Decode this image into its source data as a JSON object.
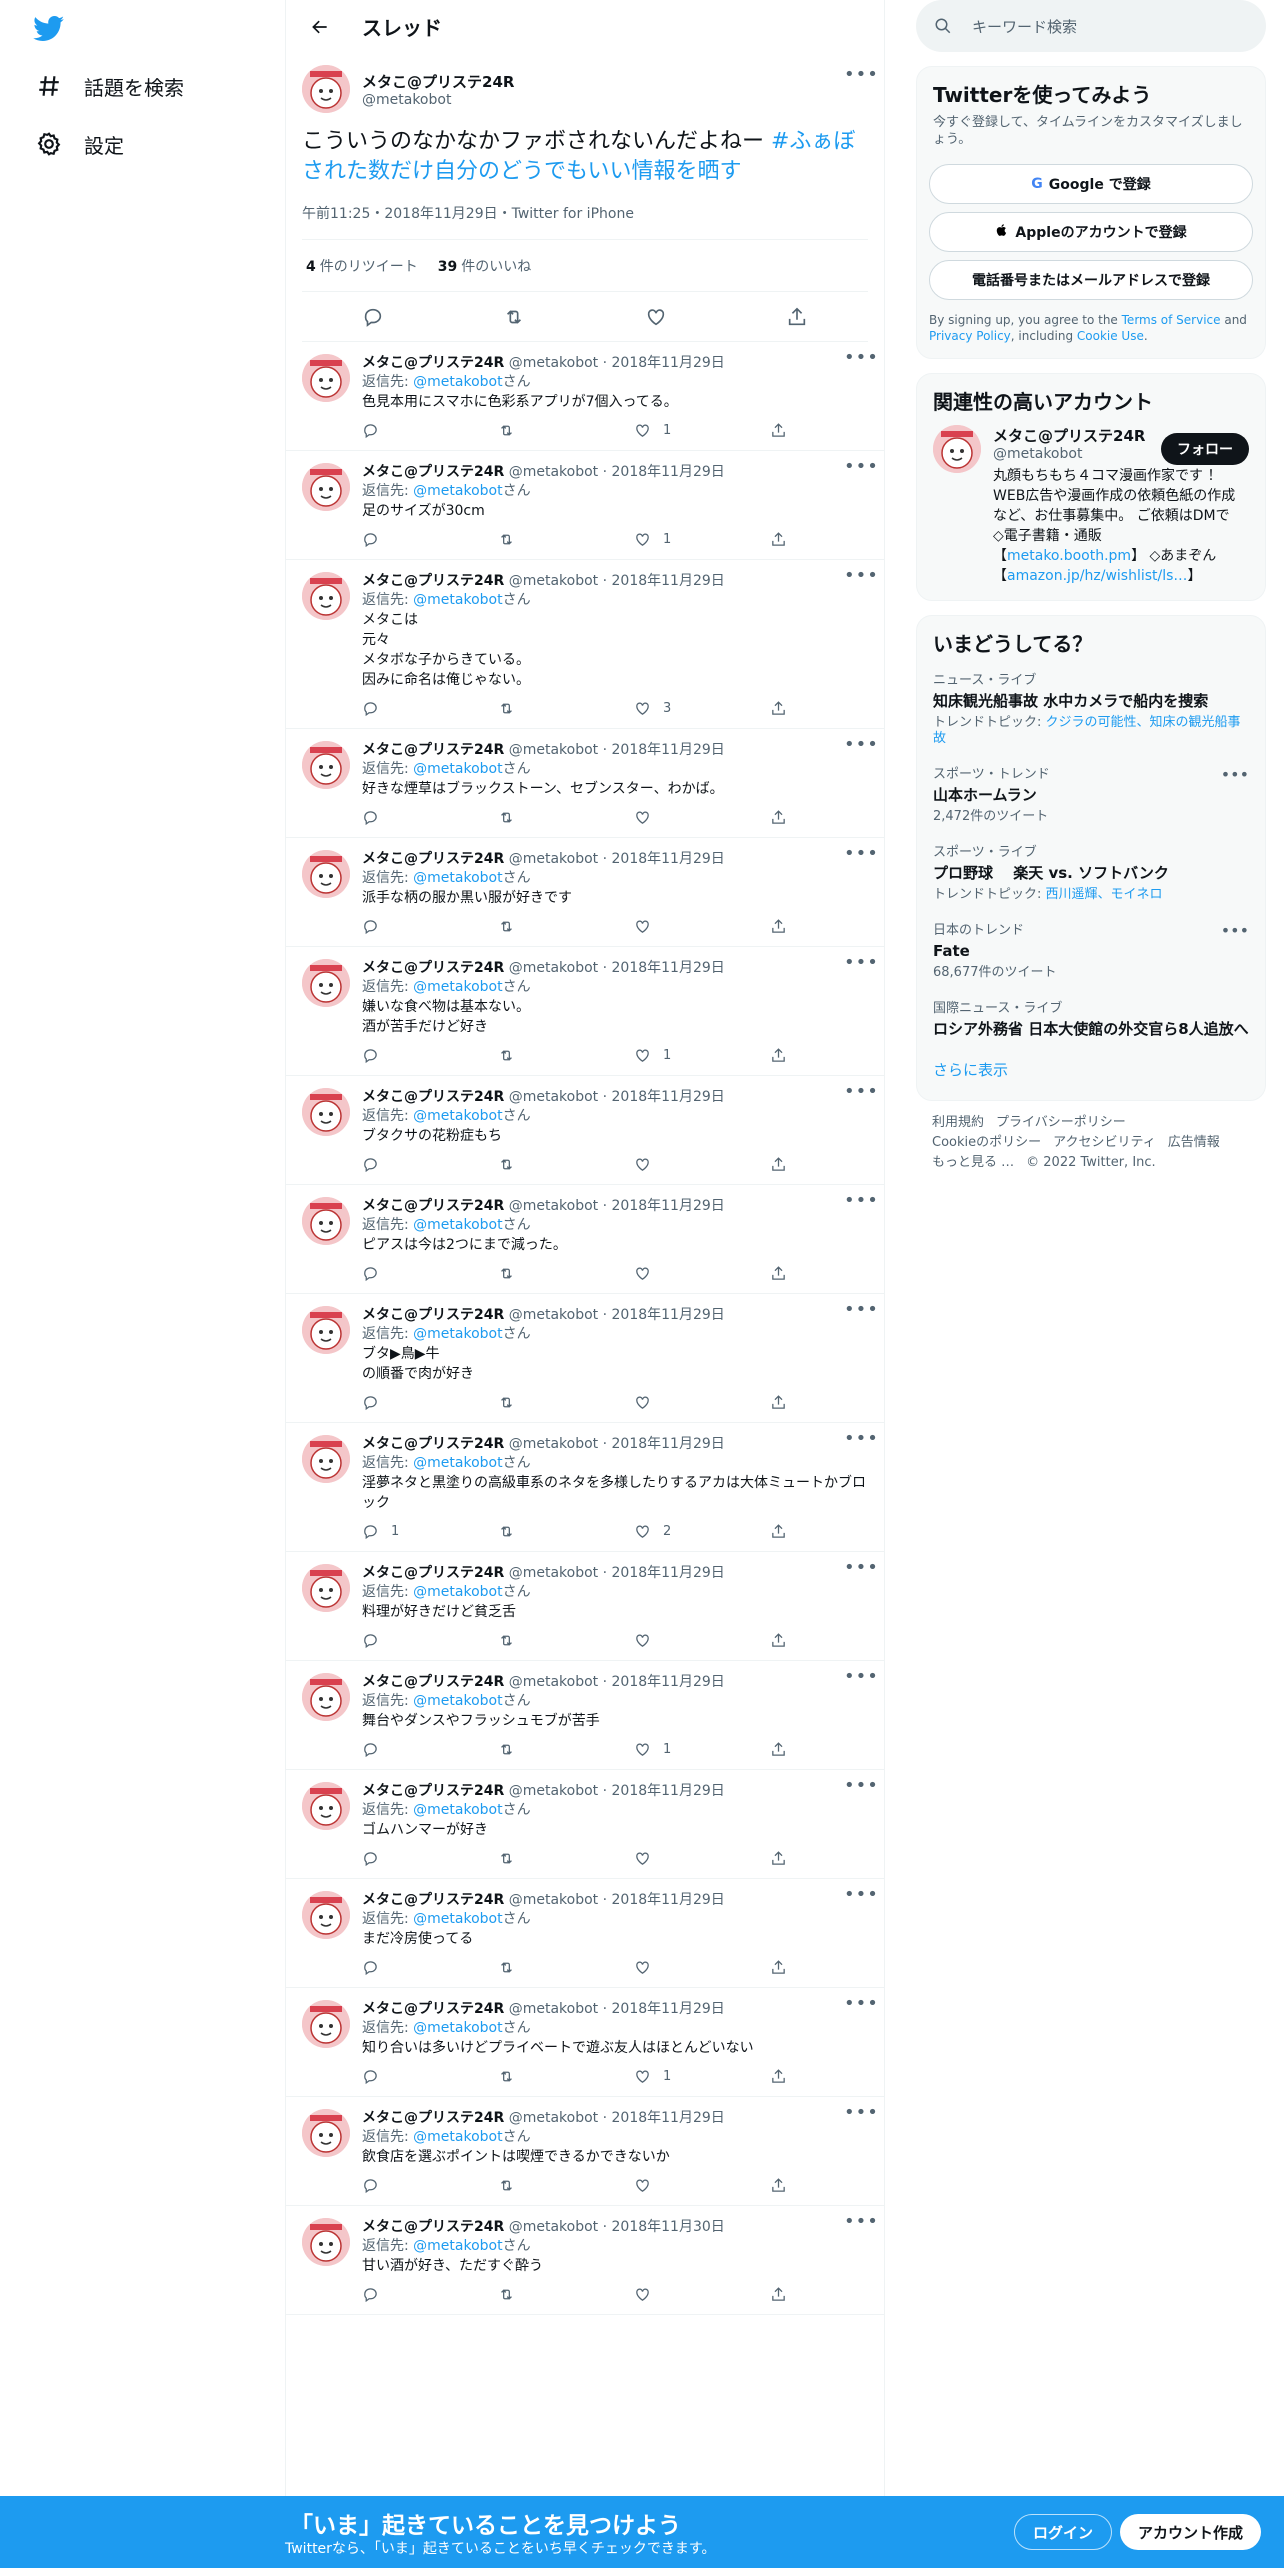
{
  "nav": {
    "explore": "話題を検索",
    "settings": "設定"
  },
  "header": {
    "title": "スレッド"
  },
  "focal": {
    "name": "メタこ@プリステ24R",
    "handle": "@metakobot",
    "text": "こういうのなかなかファボされないんだよねー ",
    "hashtag": "#ふぁぼされた数だけ自分のどうでもいい情報を晒す",
    "meta": "午前11:25・2018年11月29日・Twitter for iPhone",
    "retweets": "4",
    "retweets_label": "件のリツイート",
    "likes": "39",
    "likes_label": "件のいいね"
  },
  "reply_common": {
    "name": "メタこ@プリステ24R",
    "handle": "@metakobot",
    "to_prefix": "返信先: ",
    "to_handle": "@metakobot",
    "to_suffix": "さん"
  },
  "replies": [
    {
      "date": "2018年11月29日",
      "text": "色見本用にスマホに色彩系アプリが7個入ってる。",
      "replies": "",
      "likes": "1"
    },
    {
      "date": "2018年11月29日",
      "text": "足のサイズが30cm",
      "replies": "",
      "likes": "1"
    },
    {
      "date": "2018年11月29日",
      "text": "メタこは\n元々\nメタボな子からきている。\n因みに命名は俺じゃない。",
      "replies": "",
      "likes": "3"
    },
    {
      "date": "2018年11月29日",
      "text": "好きな煙草はブラックストーン、セブンスター、わかば。",
      "replies": "",
      "likes": ""
    },
    {
      "date": "2018年11月29日",
      "text": "派手な柄の服か黒い服が好きです",
      "replies": "",
      "likes": ""
    },
    {
      "date": "2018年11月29日",
      "text": "嫌いな食べ物は基本ない。\n酒が苦手だけど好き",
      "replies": "",
      "likes": "1"
    },
    {
      "date": "2018年11月29日",
      "text": "ブタクサの花粉症もち",
      "replies": "",
      "likes": ""
    },
    {
      "date": "2018年11月29日",
      "text": "ピアスは今は2つにまで減った。",
      "replies": "",
      "likes": ""
    },
    {
      "date": "2018年11月29日",
      "text": "ブタ▶鳥▶牛\nの順番で肉が好き",
      "replies": "",
      "likes": ""
    },
    {
      "date": "2018年11月29日",
      "text": "淫夢ネタと黒塗りの高級車系のネタを多様したりするアカは大体ミュートかブロック",
      "replies": "1",
      "likes": "2"
    },
    {
      "date": "2018年11月29日",
      "text": "料理が好きだけど貧乏舌",
      "replies": "",
      "likes": ""
    },
    {
      "date": "2018年11月29日",
      "text": "舞台やダンスやフラッシュモブが苦手",
      "replies": "",
      "likes": "1"
    },
    {
      "date": "2018年11月29日",
      "text": "ゴムハンマーが好き",
      "replies": "",
      "likes": ""
    },
    {
      "date": "2018年11月29日",
      "text": "まだ冷房使ってる",
      "replies": "",
      "likes": ""
    },
    {
      "date": "2018年11月29日",
      "text": "知り合いは多いけどプライベートで遊ぶ友人はほとんどいない",
      "replies": "",
      "likes": "1"
    },
    {
      "date": "2018年11月29日",
      "text": "飲食店を選ぶポイントは喫煙できるかできないか",
      "replies": "",
      "likes": ""
    },
    {
      "date": "2018年11月30日",
      "text": "甘い酒が好き、ただすぐ酔う",
      "replies": "",
      "likes": ""
    }
  ],
  "search": {
    "placeholder": "キーワード検索"
  },
  "signup": {
    "title": "Twitterを使ってみよう",
    "desc": "今すぐ登録して、タイムラインをカスタマイズしましょう。",
    "google": "Google で登録",
    "apple": "Appleのアカウントで登録",
    "phone": "電話番号またはメールアドレスで登録",
    "legal_1": "By signing up, you agree to the ",
    "legal_tos": "Terms of Service",
    "legal_2": " and ",
    "legal_privacy": "Privacy Policy",
    "legal_3": ", including ",
    "legal_cookie": "Cookie Use",
    "legal_4": "."
  },
  "related": {
    "title": "関連性の高いアカウント",
    "name": "メタこ@プリステ24R",
    "handle": "@metakobot",
    "follow": "フォロー",
    "bio_1": "丸顔もちもち４コマ漫画作家です ！WEB広告や漫画作成の依頼色紙の作成など、お仕事募集中。 ご依頼はDMで　 ◇電子書籍・通販【",
    "bio_link1": "metako.booth.pm",
    "bio_2": "】 ◇あまぞん【",
    "bio_link2": "amazon.jp/hz/wishlist/ls…",
    "bio_3": "】"
  },
  "trends": {
    "title": "いまどうしてる？",
    "items": [
      {
        "meta": "ニュース・ライブ",
        "title": "知床観光船事故 水中カメラで船内を捜索",
        "sub_prefix": "トレンドトピック: ",
        "sub_link": "クジラの可能性、知床の観光船事故",
        "count": ""
      },
      {
        "meta": "スポーツ・トレンド",
        "title": "山本ホームラン",
        "sub_prefix": "",
        "sub_link": "",
        "count": "2,472件のツイート"
      },
      {
        "meta": "スポーツ・ライブ",
        "title": "プロ野球　 楽天 vs. ソフトバンク",
        "sub_prefix": "トレンドトピック: ",
        "sub_link": "西川遥輝、モイネロ",
        "count": ""
      },
      {
        "meta": "日本のトレンド",
        "title": "Fate",
        "sub_prefix": "",
        "sub_link": "",
        "count": "68,677件のツイート"
      },
      {
        "meta": "国際ニュース・ライブ",
        "title": "ロシア外務省 日本大使館の外交官ら8人追放へ",
        "sub_prefix": "",
        "sub_link": "",
        "count": ""
      }
    ],
    "show_more": "さらに表示"
  },
  "footer": {
    "terms": "利用規約",
    "privacy": "プライバシーポリシー",
    "cookie": "Cookieのポリシー",
    "accessibility": "アクセシビリティ",
    "ads": "広告情報",
    "more": "もっと見る …",
    "copyright": "© 2022 Twitter, Inc."
  },
  "bottombar": {
    "title": "「いま」起きていることを見つけよう",
    "sub": "Twitterなら、「いま」起きていることをいち早くチェックできます。",
    "login": "ログイン",
    "signup": "アカウント作成"
  },
  "icons": [
    "twitter-logo",
    "hashtag-icon",
    "gear-icon",
    "back-arrow-icon",
    "reply-icon",
    "retweet-icon",
    "heart-icon",
    "share-icon",
    "search-icon",
    "google-icon",
    "apple-icon"
  ]
}
